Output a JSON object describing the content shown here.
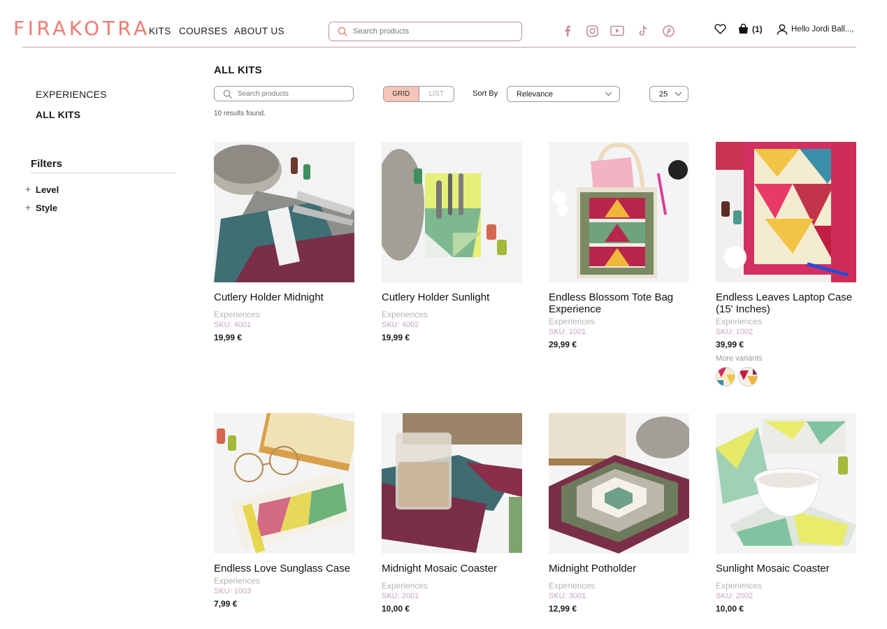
{
  "header": {
    "logo": "FIRAKOTRA",
    "nav": [
      "KITS",
      "COURSES",
      "ABOUT US"
    ],
    "search_placeholder": "Search products",
    "cart_count": "(1)",
    "user_greeting": "Hello Jordi Ball...,",
    "social_icons": [
      "facebook-icon",
      "instagram-icon",
      "youtube-icon",
      "tiktok-icon",
      "pinterest-icon"
    ],
    "colors": {
      "logo": "#f07a70",
      "social": "#c68aa6",
      "accent": "#f6c4b8"
    }
  },
  "sidebar": {
    "links": [
      "EXPERIENCES",
      "ALL KITS"
    ],
    "filters_title": "Filters",
    "filters": [
      "Level",
      "Style"
    ]
  },
  "main": {
    "title": "ALL KITS",
    "search_placeholder": "Search products",
    "view": {
      "grid": "GRID",
      "list": "LIST"
    },
    "sort_label": "Sort By",
    "sort_value": "Relevance",
    "per_page": "25",
    "results": "10 results found."
  },
  "products": [
    {
      "name": "Cutlery Holder Midnight",
      "category": "Experiences",
      "sku": "SKU: 4001",
      "price": "19,99 €"
    },
    {
      "name": "Cutlery Holder Sunlight",
      "category": "Experiences",
      "sku": "SKU: 4002",
      "price": "19,99 €"
    },
    {
      "name": "Endless Blossom Tote Bag Experience",
      "category": "Experiences",
      "sku": "SKU: 1001",
      "price": "29,99 €"
    },
    {
      "name": "Endless Leaves Laptop Case (15' Inches)",
      "category": "Experiences",
      "sku": "SKU: 1002",
      "price": "39,99 €",
      "more_variants": "More variants"
    },
    {
      "name": "Endless Love Sunglass Case",
      "category": "Experiences",
      "sku": "SKU: 1003",
      "price": "7,99 €"
    },
    {
      "name": "Midnight Mosaic Coaster",
      "category": "Experiences",
      "sku": "SKU: 2001",
      "price": "10,00 €"
    },
    {
      "name": "Midnight Potholder",
      "category": "Experiences",
      "sku": "SKU: 3001",
      "price": "12,99 €"
    },
    {
      "name": "Sunlight Mosaic Coaster",
      "category": "Experiences",
      "sku": "SKU: 2002",
      "price": "10,00 €"
    }
  ]
}
